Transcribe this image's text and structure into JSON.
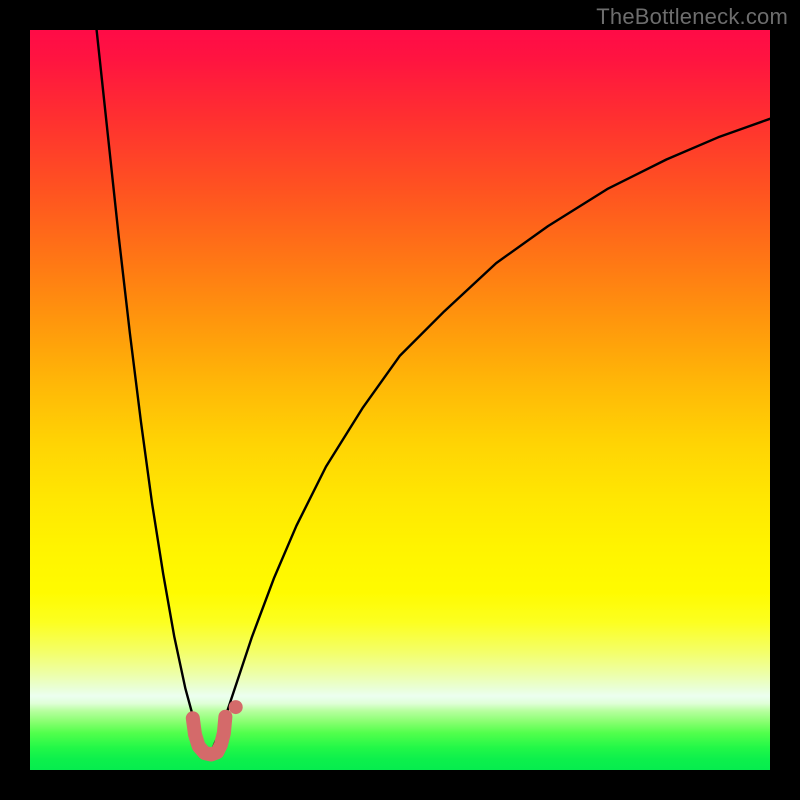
{
  "watermark": "TheBottleneck.com",
  "colors": {
    "frame_bg": "#000000",
    "curve_stroke": "#000000",
    "marker_fill": "#d46a6a",
    "gradient_top": "#ff0b47",
    "gradient_bottom": "#06ec4e"
  },
  "chart_data": {
    "type": "line",
    "title": "",
    "xlabel": "",
    "ylabel": "",
    "xlim": [
      0,
      100
    ],
    "ylim": [
      0,
      100
    ],
    "grid": false,
    "legend": false,
    "note": "x and y are normalized to percent of plot area (0–100). y=0 is bottom (green), y=100 is top (red). Two black curves form a V with minimum near x≈24, y≈2; left branch rises to top at x≈9, right branch rises asymptotically toward y≈90 at x=100. Pink markers form a small U near the minimum.",
    "series": [
      {
        "name": "left_branch",
        "x": [
          9.0,
          10.5,
          12.0,
          13.5,
          15.0,
          16.5,
          18.0,
          19.5,
          21.0,
          22.5,
          23.5
        ],
        "y": [
          100.0,
          86.0,
          72.0,
          59.0,
          47.0,
          36.0,
          26.5,
          18.0,
          11.0,
          5.5,
          2.5
        ]
      },
      {
        "name": "right_branch",
        "x": [
          24.5,
          26.0,
          28.0,
          30.0,
          33.0,
          36.0,
          40.0,
          45.0,
          50.0,
          56.0,
          63.0,
          70.0,
          78.0,
          86.0,
          93.0,
          100.0
        ],
        "y": [
          2.5,
          6.0,
          12.0,
          18.0,
          26.0,
          33.0,
          41.0,
          49.0,
          56.0,
          62.0,
          68.5,
          73.5,
          78.5,
          82.5,
          85.5,
          88.0
        ]
      },
      {
        "name": "markers_u_shape",
        "x": [
          22.0,
          22.3,
          22.8,
          23.6,
          24.5,
          25.3,
          25.8,
          26.2,
          26.4
        ],
        "y": [
          7.0,
          4.8,
          3.2,
          2.3,
          2.1,
          2.4,
          3.4,
          5.0,
          7.2
        ]
      }
    ]
  }
}
